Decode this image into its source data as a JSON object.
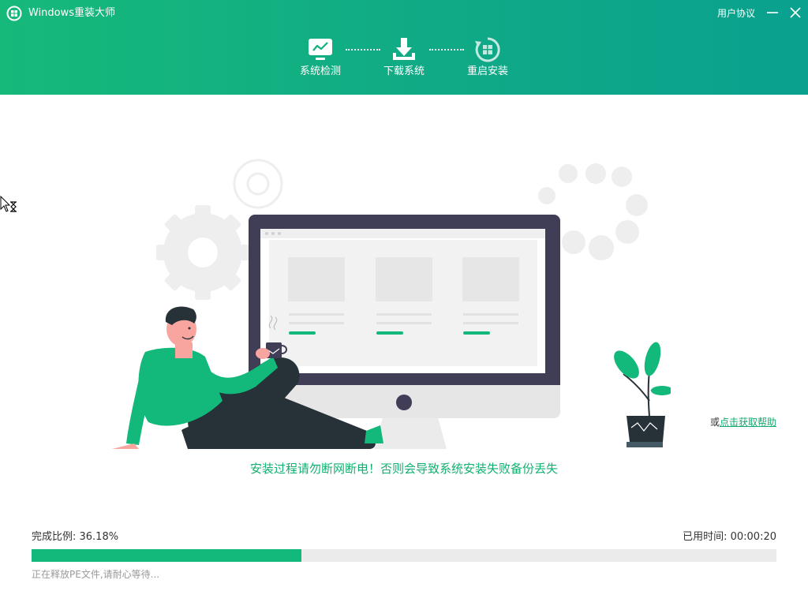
{
  "app": {
    "title": "Windows重装大师",
    "agreement_link": "用户协议"
  },
  "steps": [
    {
      "label": "系统检测",
      "icon": "monitor-chart-icon"
    },
    {
      "label": "下载系统",
      "icon": "download-icon"
    },
    {
      "label": "重启安装",
      "icon": "windows-restart-icon"
    }
  ],
  "help": {
    "prefix": "或",
    "link": "点击获取帮助"
  },
  "warning": "安装过程请勿断网断电！否则会导致系统安装失败备份丢失",
  "progress": {
    "label": "完成比例: 36.18%",
    "percent": 36.18,
    "elapsed": "已用时间: 00:00:20",
    "status": "正在释放PE文件,请耐心等待..."
  },
  "colors": {
    "accent": "#12b97a",
    "header_start": "#16b97a",
    "header_end": "#0aa18e",
    "warning_text": "#10b070"
  }
}
